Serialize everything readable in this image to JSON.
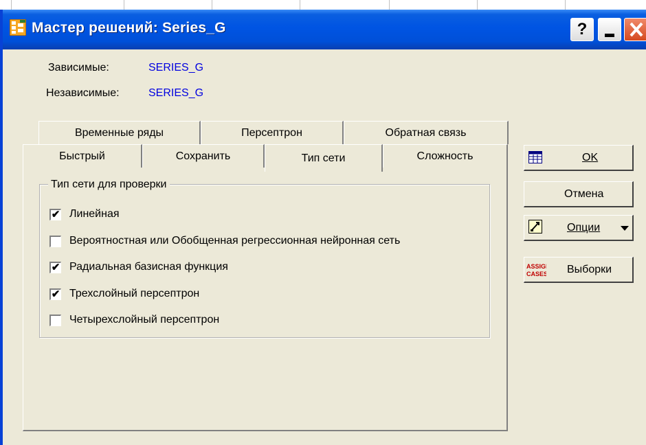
{
  "window": {
    "title": "Мастер решений: Series_G"
  },
  "title_buttons": {
    "help": "?"
  },
  "vars": {
    "dependent_label": "Зависимые:",
    "dependent_value": "SERIES_G",
    "independent_label": "Независимые:",
    "independent_value": "SERIES_G"
  },
  "tabs_row1": [
    "Временные ряды",
    "Персептрон",
    "Обратная связь"
  ],
  "tabs_row2": [
    "Быстрый",
    "Сохранить",
    "Тип сети",
    "Сложность"
  ],
  "active_tab": "Тип сети",
  "group": {
    "title": "Тип сети для проверки",
    "items": [
      {
        "label": "Линейная",
        "checked": true
      },
      {
        "label": "Вероятностная или Обобщенная регрессионная нейронная сеть",
        "checked": false
      },
      {
        "label": "Радиальная базисная функция",
        "checked": true
      },
      {
        "label": "Трехслойный персептрон",
        "checked": true
      },
      {
        "label": "Четырехслойный персептрон",
        "checked": false
      }
    ]
  },
  "buttons": {
    "ok": "OK",
    "cancel": "Отмена",
    "options": "Опции",
    "samples": "Выборки",
    "assign_cases_icon_text": "ASSIGN CASES"
  },
  "checkmark_glyph": "✔"
}
